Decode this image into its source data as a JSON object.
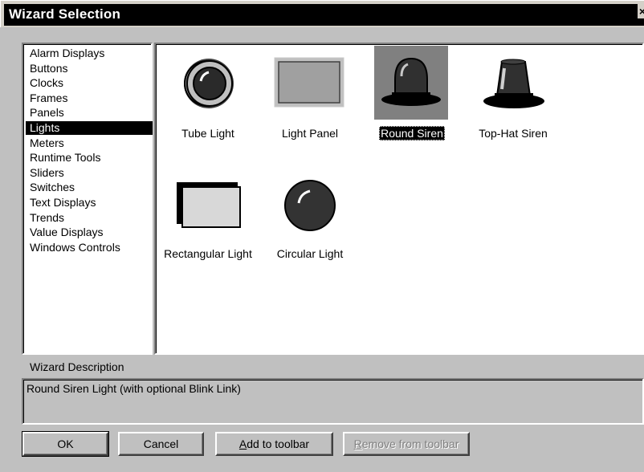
{
  "window": {
    "title": "Wizard Selection",
    "close_glyph": "×"
  },
  "categories": [
    {
      "label": "Alarm Displays",
      "selected": false
    },
    {
      "label": "Buttons",
      "selected": false
    },
    {
      "label": "Clocks",
      "selected": false
    },
    {
      "label": "Frames",
      "selected": false
    },
    {
      "label": "Panels",
      "selected": false
    },
    {
      "label": "Lights",
      "selected": true
    },
    {
      "label": "Meters",
      "selected": false
    },
    {
      "label": "Runtime Tools",
      "selected": false
    },
    {
      "label": "Sliders",
      "selected": false
    },
    {
      "label": "Switches",
      "selected": false
    },
    {
      "label": "Text Displays",
      "selected": false
    },
    {
      "label": "Trends",
      "selected": false
    },
    {
      "label": "Value Displays",
      "selected": false
    },
    {
      "label": "Windows Controls",
      "selected": false
    }
  ],
  "wizards": [
    {
      "label": "Tube Light",
      "icon": "tube-light-icon",
      "selected": false
    },
    {
      "label": "Light Panel",
      "icon": "light-panel-icon",
      "selected": false
    },
    {
      "label": "Round Siren",
      "icon": "round-siren-icon",
      "selected": true
    },
    {
      "label": "Top-Hat Siren",
      "icon": "top-hat-siren-icon",
      "selected": false
    },
    {
      "label": "Rectangular Light",
      "icon": "rectangular-light-icon",
      "selected": false
    },
    {
      "label": "Circular Light",
      "icon": "circular-light-icon",
      "selected": false
    }
  ],
  "description": {
    "label": "Wizard Description",
    "text": "Round Siren Light (with optional Blink Link)"
  },
  "buttons": {
    "ok": "OK",
    "cancel": "Cancel",
    "add_prefix": "",
    "add_mnemonic": "A",
    "add_rest": "dd to toolbar",
    "remove_mnemonic": "R",
    "remove_rest": "emove from toolbar"
  },
  "colors": {
    "title_bg": "#000000",
    "dialog_bg": "#c0c0c0",
    "selection_bg": "#000000",
    "icon_highlight_bg": "#808080"
  }
}
